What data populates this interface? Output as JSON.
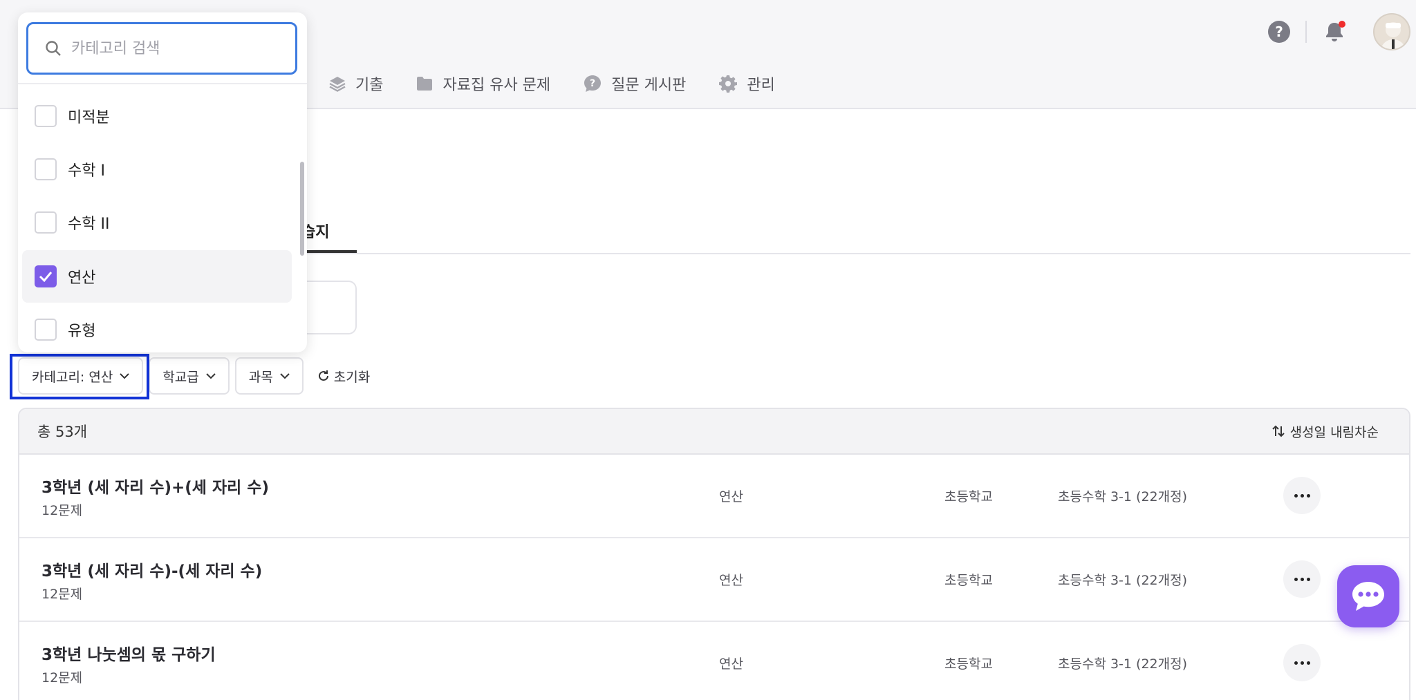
{
  "header": {
    "nav": [
      {
        "label": "기출",
        "icon": "layers-icon"
      },
      {
        "label": "자료집 유사 문제",
        "icon": "folder-icon"
      },
      {
        "label": "질문 게시판",
        "icon": "question-bubble-icon"
      },
      {
        "label": "관리",
        "icon": "gear-icon"
      }
    ]
  },
  "tabs": {
    "active_label": "습지"
  },
  "dropdown": {
    "search_placeholder": "카테고리 검색",
    "items": [
      {
        "label": "미적분",
        "checked": false
      },
      {
        "label": "수학 I",
        "checked": false
      },
      {
        "label": "수학 II",
        "checked": false
      },
      {
        "label": "연산",
        "checked": true
      },
      {
        "label": "유형",
        "checked": false
      }
    ]
  },
  "filters": {
    "category": "카테고리: 연산",
    "school_level": "학교급",
    "subject": "과목",
    "reset": "초기화"
  },
  "table": {
    "total": "총 53개",
    "sort": "생성일 내림차순",
    "rows": [
      {
        "title": "3학년 (세 자리 수)+(세 자리 수)",
        "count": "12문제",
        "category": "연산",
        "school": "초등학교",
        "course": "초등수학 3-1 (22개정)"
      },
      {
        "title": "3학년 (세 자리 수)-(세 자리 수)",
        "count": "12문제",
        "category": "연산",
        "school": "초등학교",
        "course": "초등수학 3-1 (22개정)"
      },
      {
        "title": "3학년 나눗셈의 몫 구하기",
        "count": "12문제",
        "category": "연산",
        "school": "초등학교",
        "course": "초등수학 3-1 (22개정)"
      }
    ]
  },
  "colors": {
    "accent": "#8b5cf0",
    "checkbox": "#7c5ce8",
    "highlight": "#1233d6",
    "search_focus": "#3d7be0"
  }
}
